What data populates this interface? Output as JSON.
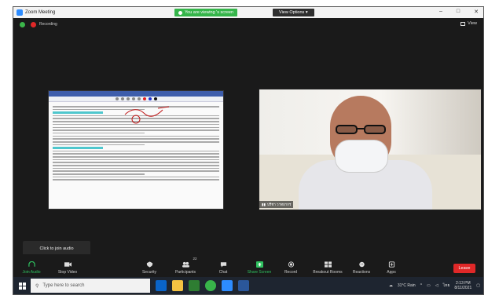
{
  "window": {
    "title": "Zoom Meeting",
    "share_banner": "You are viewing",
    "share_banner_name": "'s screen",
    "view_options": "View Options",
    "controls": [
      "–",
      "□",
      "✕"
    ]
  },
  "meeting": {
    "recording_label": "Recording",
    "view_label": "View"
  },
  "participant": {
    "name": "ปรีชา วาทยากร"
  },
  "tooltip": {
    "text": "Click to join audio"
  },
  "toolbar": {
    "join_audio": "Join Audio",
    "stop_video": "Stop Video",
    "security": "Security",
    "participants": "Participants",
    "participants_count": "22",
    "chat": "Chat",
    "share_screen": "Share Screen",
    "record": "Record",
    "breakout_rooms": "Breakout Rooms",
    "reactions": "Reactions",
    "apps": "Apps",
    "leave": "Leave"
  },
  "taskbar": {
    "search_placeholder": "Type here to search",
    "weather": "31°C Rain",
    "language": "ไทย",
    "time": "2:13 PM",
    "date": "8/11/2021"
  },
  "colors": {
    "accent_green": "#35b54a",
    "leave_red": "#e02828",
    "zoom_blue": "#2d8cff"
  }
}
